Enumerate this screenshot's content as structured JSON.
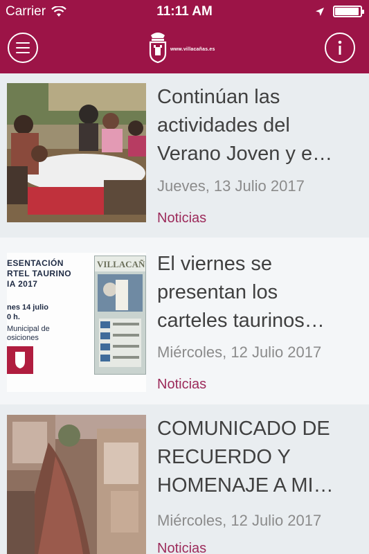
{
  "status_bar": {
    "carrier": "Carrier",
    "time": "11:11 AM"
  },
  "header": {
    "site_url": "www.villacañas.es"
  },
  "news": [
    {
      "title_line1": "Continúan las",
      "title_line2": "actividades del",
      "title_line3": "Verano Joven y e…",
      "date": "Jueves, 13 Julio 2017",
      "category": "Noticias"
    },
    {
      "title_line1": "El viernes se",
      "title_line2": "presentan los",
      "title_line3": "carteles taurinos…",
      "date": "Miércoles, 12 Julio 2017",
      "category": "Noticias",
      "poster": {
        "line1": "ESENTACIÓN",
        "line2": "RTEL TAURINO",
        "line3": "IA 2017",
        "date_line1": "nes 14 julio",
        "date_line2": "0 h.",
        "place_line1": "Municipal de",
        "place_line2": "osiciones",
        "mini_title": "VILLACAÑ"
      }
    },
    {
      "title_line1": "COMUNICADO DE",
      "title_line2": "RECUERDO Y",
      "title_line3": "HOMENAJE A MI…",
      "date": "Miércoles, 12 Julio 2017",
      "category": "Noticias"
    }
  ],
  "colors": {
    "brand": "#9c1447",
    "category_text": "#9c2a5a",
    "title_text": "#404040",
    "date_text": "#8b8b8b"
  }
}
